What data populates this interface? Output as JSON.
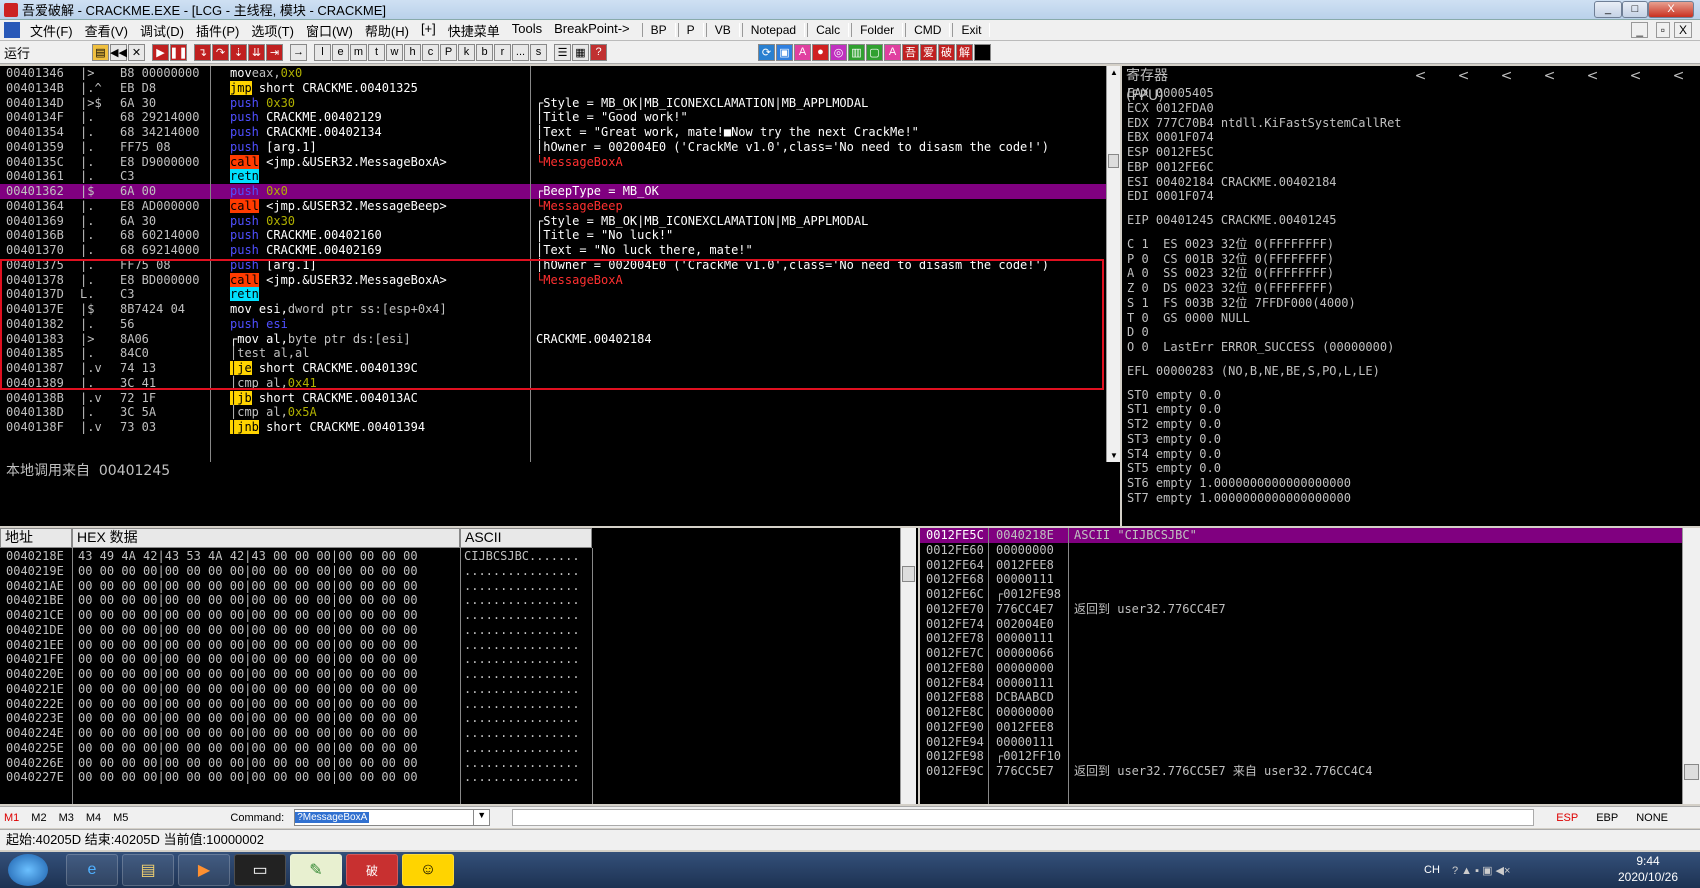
{
  "window": {
    "title": "吾爱破解 - CRACKME.EXE - [LCG - 主线程, 模块 - CRACKME]",
    "min": "_",
    "max": "□",
    "close": "X",
    "inner_min": "_",
    "inner_max": "▫",
    "inner_close": "X"
  },
  "menu": {
    "items": [
      "文件(F)",
      "查看(V)",
      "调试(D)",
      "插件(P)",
      "选项(T)",
      "窗口(W)",
      "帮助(H)",
      "[+]",
      "快捷菜单",
      "Tools",
      "BreakPoint->"
    ],
    "tools": [
      "BP",
      "P",
      "VB",
      "Notepad",
      "Calc",
      "Folder",
      "CMD",
      "Exit"
    ]
  },
  "toolbar": {
    "status": "运行",
    "letters": [
      "l",
      "e",
      "m",
      "t",
      "w",
      "h",
      "c",
      "P",
      "k",
      "b",
      "r",
      "...",
      "s"
    ],
    "right_btns": [
      "A",
      "吾",
      "爱",
      "破",
      "解"
    ]
  },
  "disasm": {
    "rows": [
      {
        "addr": "00401346",
        "mark": "|> ",
        "hex": "B8 00000000",
        "ins": [
          [
            "kw-mov",
            "mov"
          ],
          [
            "",
            "eax,"
          ],
          [
            "imm",
            "0x0"
          ]
        ],
        "cmt": ""
      },
      {
        "addr": "0040134B",
        "mark": "|.^",
        "hex": "EB D8",
        "ins": [
          [
            "kw-jmp",
            "jmp"
          ],
          [
            "wh",
            " short CRACKME.00401325"
          ]
        ],
        "cmt": ""
      },
      {
        "addr": "0040134D",
        "mark": "|>$",
        "hex": "6A 30",
        "ins": [
          [
            "kw-push",
            "push"
          ],
          [
            "imm",
            " 0x30"
          ]
        ],
        "cmt": "┌Style = MB_OK|MB_ICONEXCLAMATION|MB_APPLMODAL"
      },
      {
        "addr": "0040134F",
        "mark": "|.",
        "hex": "68 29214000",
        "ins": [
          [
            "kw-push",
            "push"
          ],
          [
            "wh",
            " CRACKME.00402129"
          ]
        ],
        "cmt": "│Title = \"Good work!\""
      },
      {
        "addr": "00401354",
        "mark": "|.",
        "hex": "68 34214000",
        "ins": [
          [
            "kw-push",
            "push"
          ],
          [
            "wh",
            " CRACKME.00402134"
          ]
        ],
        "cmt": "│Text = \"Great work, mate!■Now try the next CrackMe!\""
      },
      {
        "addr": "00401359",
        "mark": "|.",
        "hex": "FF75 08",
        "ins": [
          [
            "kw-push",
            "push"
          ],
          [
            "wh",
            " [arg.1]"
          ]
        ],
        "cmt": "│hOwner = 002004E0 ('CrackMe v1.0',class='No need to disasm the code!')"
      },
      {
        "addr": "0040135C",
        "mark": "|.",
        "hex": "E8 D9000000",
        "ins": [
          [
            "kw-call",
            "call"
          ],
          [
            "wh",
            " <jmp.&USER32.MessageBoxA>"
          ]
        ],
        "cmt": "└MessageBoxA",
        "red": true
      },
      {
        "addr": "00401361",
        "mark": "|.",
        "hex": "C3",
        "ins": [
          [
            "kw-ret",
            "retn"
          ]
        ],
        "cmt": ""
      },
      {
        "addr": "00401362",
        "mark": "|$",
        "hex": "6A 00",
        "ins": [
          [
            "kw-push",
            "push"
          ],
          [
            "imm",
            " 0x0"
          ]
        ],
        "cmt": "┌BeepType = MB_OK",
        "hl": true
      },
      {
        "addr": "00401364",
        "mark": "|.",
        "hex": "E8 AD000000",
        "ins": [
          [
            "kw-call",
            "call"
          ],
          [
            "wh",
            " <jmp.&USER32.MessageBeep>"
          ]
        ],
        "cmt": "└MessageBeep",
        "red": true
      },
      {
        "addr": "00401369",
        "mark": "|.",
        "hex": "6A 30",
        "ins": [
          [
            "kw-push",
            "push"
          ],
          [
            "imm",
            " 0x30"
          ]
        ],
        "cmt": "┌Style = MB_OK|MB_ICONEXCLAMATION|MB_APPLMODAL"
      },
      {
        "addr": "0040136B",
        "mark": "|.",
        "hex": "68 60214000",
        "ins": [
          [
            "kw-push",
            "push"
          ],
          [
            "wh",
            " CRACKME.00402160"
          ]
        ],
        "cmt": "│Title = \"No luck!\""
      },
      {
        "addr": "00401370",
        "mark": "|.",
        "hex": "68 69214000",
        "ins": [
          [
            "kw-push",
            "push"
          ],
          [
            "wh",
            " CRACKME.00402169"
          ]
        ],
        "cmt": "│Text = \"No luck there, mate!\""
      },
      {
        "addr": "00401375",
        "mark": "|.",
        "hex": "FF75 08",
        "ins": [
          [
            "kw-push",
            "push"
          ],
          [
            "wh",
            " [arg.1]"
          ]
        ],
        "cmt": "│hOwner = 002004E0 ('CrackMe v1.0',class='No need to disasm the code!')"
      },
      {
        "addr": "00401378",
        "mark": "|.",
        "hex": "E8 BD000000",
        "ins": [
          [
            "kw-call",
            "call"
          ],
          [
            "wh",
            " <jmp.&USER32.MessageBoxA>"
          ]
        ],
        "cmt": "└MessageBoxA",
        "red": true
      },
      {
        "addr": "0040137D",
        "mark": "L.",
        "hex": "C3",
        "ins": [
          [
            "kw-ret",
            "retn"
          ]
        ],
        "cmt": ""
      },
      {
        "addr": "0040137E",
        "mark": "|$",
        "hex": "8B7424 04",
        "ins": [
          [
            "kw-mov",
            "mov"
          ],
          [
            "wh",
            " esi,"
          ],
          [
            "",
            "dword ptr ss:[esp+0x4]"
          ]
        ],
        "cmt": ""
      },
      {
        "addr": "00401382",
        "mark": "|.",
        "hex": "56",
        "ins": [
          [
            "kw-push",
            "push"
          ],
          [
            "kw-push",
            " esi"
          ]
        ],
        "cmt": ""
      },
      {
        "addr": "00401383",
        "mark": "|>",
        "hex": "8A06",
        "ins": [
          [
            "kw-mov",
            "┌mov"
          ],
          [
            "wh",
            " al,"
          ],
          [
            "",
            "byte ptr ds:[esi]"
          ]
        ],
        "cmt": "CRACKME.00402184"
      },
      {
        "addr": "00401385",
        "mark": "|.",
        "hex": "84C0",
        "ins": [
          [
            "",
            "│test al,al"
          ]
        ],
        "cmt": ""
      },
      {
        "addr": "00401387",
        "mark": "|.v",
        "hex": "74 13",
        "ins": [
          [
            "kw-jmp",
            "│je"
          ],
          [
            "wh",
            " short CRACKME.0040139C"
          ]
        ],
        "cmt": ""
      },
      {
        "addr": "00401389",
        "mark": "|.",
        "hex": "3C 41",
        "ins": [
          [
            "",
            "│cmp al,"
          ],
          [
            "imm",
            "0x41"
          ]
        ],
        "cmt": ""
      },
      {
        "addr": "0040138B",
        "mark": "|.v",
        "hex": "72 1F",
        "ins": [
          [
            "kw-jmp",
            "│jb"
          ],
          [
            "wh",
            " short CRACKME.004013AC"
          ]
        ],
        "cmt": ""
      },
      {
        "addr": "0040138D",
        "mark": "|.",
        "hex": "3C 5A",
        "ins": [
          [
            "",
            "│cmp al,"
          ],
          [
            "imm",
            "0x5A"
          ]
        ],
        "cmt": ""
      },
      {
        "addr": "0040138F",
        "mark": "|.v",
        "hex": "73 03",
        "ins": [
          [
            "kw-jmp",
            "│jnb"
          ],
          [
            "wh",
            " short CRACKME.00401394"
          ]
        ],
        "cmt": ""
      }
    ],
    "info": "本地调用来自  00401245"
  },
  "registers": {
    "header": "寄存器 (FPU)",
    "arrows": [
      "<",
      "<",
      "<",
      "<",
      "<",
      "<",
      "<"
    ],
    "lines": [
      "EAX 00005405",
      "ECX 0012FDA0",
      "EDX 777C70B4 ntdll.KiFastSystemCallRet",
      "EBX 0001F074",
      "ESP 0012FE5C",
      "EBP 0012FE6C",
      "ESI 00402184 CRACKME.00402184",
      "EDI 0001F074",
      "",
      "EIP 00401245 CRACKME.00401245",
      "",
      "C 1  ES 0023 32位 0(FFFFFFFF)",
      "P 0  CS 001B 32位 0(FFFFFFFF)",
      "A 0  SS 0023 32位 0(FFFFFFFF)",
      "Z 0  DS 0023 32位 0(FFFFFFFF)",
      "S 1  FS 003B 32位 7FFDF000(4000)",
      "T 0  GS 0000 NULL",
      "D 0",
      "O 0  LastErr ERROR_SUCCESS (00000000)",
      "",
      "EFL 00000283 (NO,B,NE,BE,S,PO,L,LE)",
      "",
      "ST0 empty 0.0",
      "ST1 empty 0.0",
      "ST2 empty 0.0",
      "ST3 empty 0.0",
      "ST4 empty 0.0",
      "ST5 empty 0.0",
      "ST6 empty 1.0000000000000000000",
      "ST7 empty 1.0000000000000000000"
    ]
  },
  "dump": {
    "headers": [
      "地址",
      "HEX 数据",
      "ASCII"
    ],
    "rows": [
      [
        "0040218E",
        "43 49 4A 42|43 53 4A 42|43 00 00 00|00 00 00 00",
        "CIJBCSJBC......."
      ],
      [
        "0040219E",
        "00 00 00 00|00 00 00 00|00 00 00 00|00 00 00 00",
        "................"
      ],
      [
        "004021AE",
        "00 00 00 00|00 00 00 00|00 00 00 00|00 00 00 00",
        "................"
      ],
      [
        "004021BE",
        "00 00 00 00|00 00 00 00|00 00 00 00|00 00 00 00",
        "................"
      ],
      [
        "004021CE",
        "00 00 00 00|00 00 00 00|00 00 00 00|00 00 00 00",
        "................"
      ],
      [
        "004021DE",
        "00 00 00 00|00 00 00 00|00 00 00 00|00 00 00 00",
        "................"
      ],
      [
        "004021EE",
        "00 00 00 00|00 00 00 00|00 00 00 00|00 00 00 00",
        "................"
      ],
      [
        "004021FE",
        "00 00 00 00|00 00 00 00|00 00 00 00|00 00 00 00",
        "................"
      ],
      [
        "0040220E",
        "00 00 00 00|00 00 00 00|00 00 00 00|00 00 00 00",
        "................"
      ],
      [
        "0040221E",
        "00 00 00 00|00 00 00 00|00 00 00 00|00 00 00 00",
        "................"
      ],
      [
        "0040222E",
        "00 00 00 00|00 00 00 00|00 00 00 00|00 00 00 00",
        "................"
      ],
      [
        "0040223E",
        "00 00 00 00|00 00 00 00|00 00 00 00|00 00 00 00",
        "................"
      ],
      [
        "0040224E",
        "00 00 00 00|00 00 00 00|00 00 00 00|00 00 00 00",
        "................"
      ],
      [
        "0040225E",
        "00 00 00 00|00 00 00 00|00 00 00 00|00 00 00 00",
        "................"
      ],
      [
        "0040226E",
        "00 00 00 00|00 00 00 00|00 00 00 00|00 00 00 00",
        "................"
      ],
      [
        "0040227E",
        "00 00 00 00|00 00 00 00|00 00 00 00|00 00 00 00",
        "................"
      ]
    ]
  },
  "stack": {
    "rows": [
      [
        "0012FE5C",
        "0040218E",
        "ASCII \"CIJBCSJBC\"",
        true
      ],
      [
        "0012FE60",
        "00000000",
        "",
        false
      ],
      [
        "0012FE64",
        "0012FEE8",
        "",
        false
      ],
      [
        "0012FE68",
        "00000111",
        "",
        false
      ],
      [
        "0012FE6C",
        "┌0012FE98",
        "",
        false
      ],
      [
        "0012FE70",
        "776CC4E7",
        "返回到 user32.776CC4E7",
        false
      ],
      [
        "0012FE74",
        "002004E0",
        "",
        false
      ],
      [
        "0012FE78",
        "00000111",
        "",
        false
      ],
      [
        "0012FE7C",
        "00000066",
        "",
        false
      ],
      [
        "0012FE80",
        "00000000",
        "",
        false
      ],
      [
        "0012FE84",
        "00000111",
        "",
        false
      ],
      [
        "0012FE88",
        "DCBAABCD",
        "",
        false
      ],
      [
        "0012FE8C",
        "00000000",
        "",
        false
      ],
      [
        "0012FE90",
        "0012FEE8",
        "",
        false
      ],
      [
        "0012FE94",
        "00000111",
        "",
        false
      ],
      [
        "0012FE98",
        "┌0012FF10",
        "",
        false
      ],
      [
        "0012FE9C",
        "776CC5E7",
        "返回到 user32.776CC5E7 来自 user32.776CC4C4",
        false
      ]
    ]
  },
  "cmdbar": {
    "markers": [
      "M1",
      "M2",
      "M3",
      "M4",
      "M5"
    ],
    "label": "Command:",
    "value": "?MessageBoxA",
    "regs": [
      "ESP",
      "EBP",
      "NONE"
    ]
  },
  "statusbar": {
    "text": "起始:40205D 结束:40205D 当前值:10000002"
  },
  "tray": {
    "lang": "CH",
    "time": "9:44",
    "date": "2020/10/26"
  }
}
